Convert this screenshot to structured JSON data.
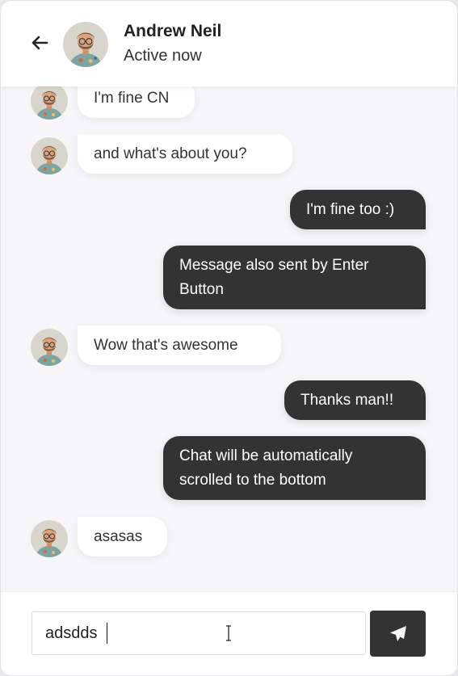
{
  "header": {
    "name": "Andrew Neil",
    "status": "Active now"
  },
  "messages": [
    {
      "type": "incoming",
      "text": "I'm fine CN"
    },
    {
      "type": "incoming",
      "text": "and what's about you?"
    },
    {
      "type": "outgoing",
      "text": "I'm fine too :)"
    },
    {
      "type": "outgoing",
      "text": "Message also sent by Enter Button"
    },
    {
      "type": "incoming",
      "text": "Wow that's awesome"
    },
    {
      "type": "outgoing",
      "text": "Thanks man!!"
    },
    {
      "type": "outgoing",
      "text": "Chat will be automatically scrolled to the bottom"
    },
    {
      "type": "incoming",
      "text": "asasas"
    }
  ],
  "composer": {
    "value": "adsdds"
  },
  "icons": {
    "back": "arrow-left-icon",
    "send": "paper-plane-icon"
  },
  "colors": {
    "outgoing_bubble": "#333333",
    "incoming_bubble": "#ffffff",
    "background": "#f6f6f8"
  }
}
